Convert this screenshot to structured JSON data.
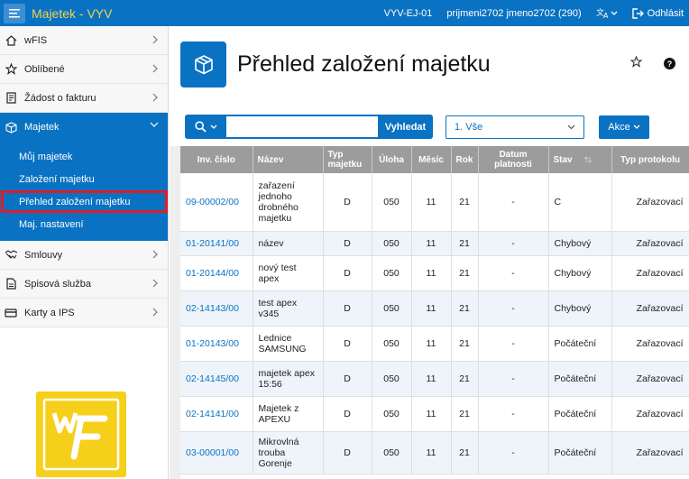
{
  "topbar": {
    "app_title": "Majetek - VYV",
    "unit": "VYV-EJ-01",
    "user": "prijmeni2702 jmeno2702 (290)",
    "logout_label": "Odhlásit"
  },
  "sidebar": {
    "items": [
      {
        "label": "wFIS",
        "icon": "home-icon"
      },
      {
        "label": "Oblíbené",
        "icon": "star-icon"
      },
      {
        "label": "Žádost o fakturu",
        "icon": "document-icon"
      },
      {
        "label": "Majetek",
        "icon": "box-icon"
      }
    ],
    "submenu": [
      "Můj majetek",
      "Založení majetku",
      "Přehled založení majetku",
      "Maj. nastavení"
    ],
    "items_after": [
      {
        "label": "Smlouvy",
        "icon": "handshake-icon"
      },
      {
        "label": "Spisová služba",
        "icon": "file-icon"
      },
      {
        "label": "Karty a IPS",
        "icon": "card-icon"
      }
    ]
  },
  "page": {
    "title": "Přehled založení majetku",
    "help": "?"
  },
  "toolbar": {
    "search_value": "",
    "search_button": "Vyhledat",
    "report_value": "1. Vše",
    "actions_label": "Akce"
  },
  "table": {
    "headers": [
      "Inv. číslo",
      "Název",
      "Typ majetku",
      "Úloha",
      "Měsíc",
      "Rok",
      "Datum platnosti",
      "Stav",
      "Typ protokolu"
    ],
    "rows": [
      [
        "09-00002/00",
        "zařazení jednoho drobného majetku",
        "D",
        "050",
        "11",
        "21",
        "-",
        "C",
        "Zařazovací"
      ],
      [
        "01-20141/00",
        "název",
        "D",
        "050",
        "11",
        "21",
        "-",
        "Chybový",
        "Zařazovací"
      ],
      [
        "01-20144/00",
        "nový test apex",
        "D",
        "050",
        "11",
        "21",
        "-",
        "Chybový",
        "Zařazovací"
      ],
      [
        "02-14143/00",
        "test apex v345",
        "D",
        "050",
        "11",
        "21",
        "-",
        "Chybový",
        "Zařazovací"
      ],
      [
        "01-20143/00",
        "Lednice SAMSUNG",
        "D",
        "050",
        "11",
        "21",
        "-",
        "Počáteční",
        "Zařazovací"
      ],
      [
        "02-14145/00",
        "majetek apex 15:56",
        "D",
        "050",
        "11",
        "21",
        "-",
        "Počáteční",
        "Zařazovací"
      ],
      [
        "02-14141/00",
        "Majetek z APEXU",
        "D",
        "050",
        "11",
        "21",
        "-",
        "Počáteční",
        "Zařazovací"
      ],
      [
        "03-00001/00",
        "Mikrovlná trouba Gorenje",
        "D",
        "050",
        "11",
        "21",
        "-",
        "Počáteční",
        "Zařazovací"
      ]
    ]
  },
  "colors": {
    "primary": "#0a72c2",
    "title_yellow": "#f2d34c",
    "selected_border": "#e31b23",
    "logo_yellow": "#f5cf1a"
  }
}
